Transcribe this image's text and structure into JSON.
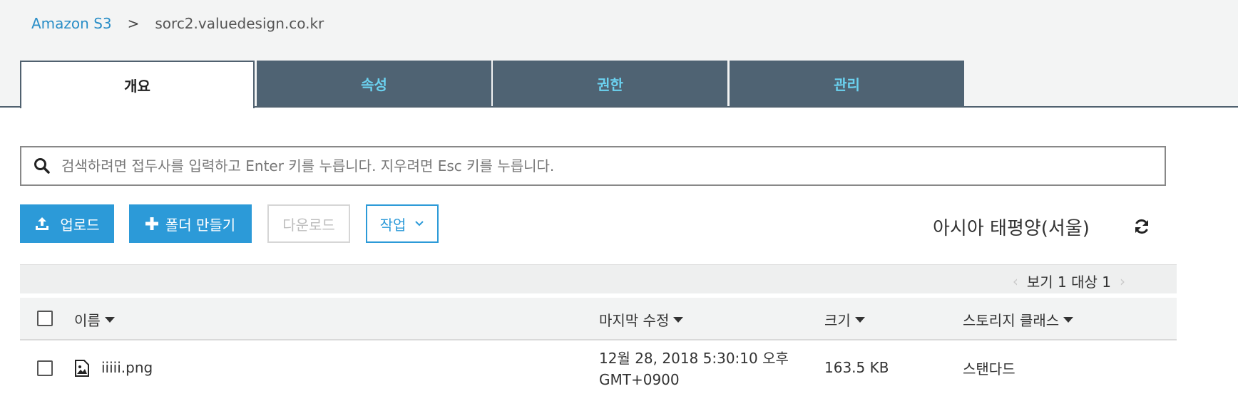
{
  "breadcrumb": {
    "root": "Amazon S3",
    "separator": ">",
    "current": "sorc2.valuedesign.co.kr"
  },
  "tabs": [
    {
      "label": "개요",
      "active": true
    },
    {
      "label": "속성",
      "active": false
    },
    {
      "label": "권한",
      "active": false
    },
    {
      "label": "관리",
      "active": false
    }
  ],
  "search": {
    "placeholder": "검색하려면 접두사를 입력하고 Enter 키를 누릅니다. 지우려면 Esc 키를 누릅니다.",
    "value": ""
  },
  "toolbar": {
    "upload_label": "업로드",
    "create_folder_label": "폴더 만들기",
    "download_label": "다운로드",
    "actions_label": "작업"
  },
  "region": "아시아 태평양(서울)",
  "pager": {
    "prev": "‹",
    "next": "›",
    "text": "보기 1 대상 1"
  },
  "table": {
    "headers": {
      "name": "이름",
      "last_modified": "마지막 수정",
      "size": "크기",
      "storage_class": "스토리지 클래스"
    },
    "rows": [
      {
        "name": "iiiii.png",
        "last_modified_line1": "12월 28, 2018 5:30:10 오후",
        "last_modified_line2": "GMT+0900",
        "size": "163.5 KB",
        "storage_class": "스탠다드"
      }
    ]
  },
  "colors": {
    "accent": "#2c9ad8",
    "tab_bg": "#4f6373",
    "tab_text": "#6bd2f0"
  }
}
